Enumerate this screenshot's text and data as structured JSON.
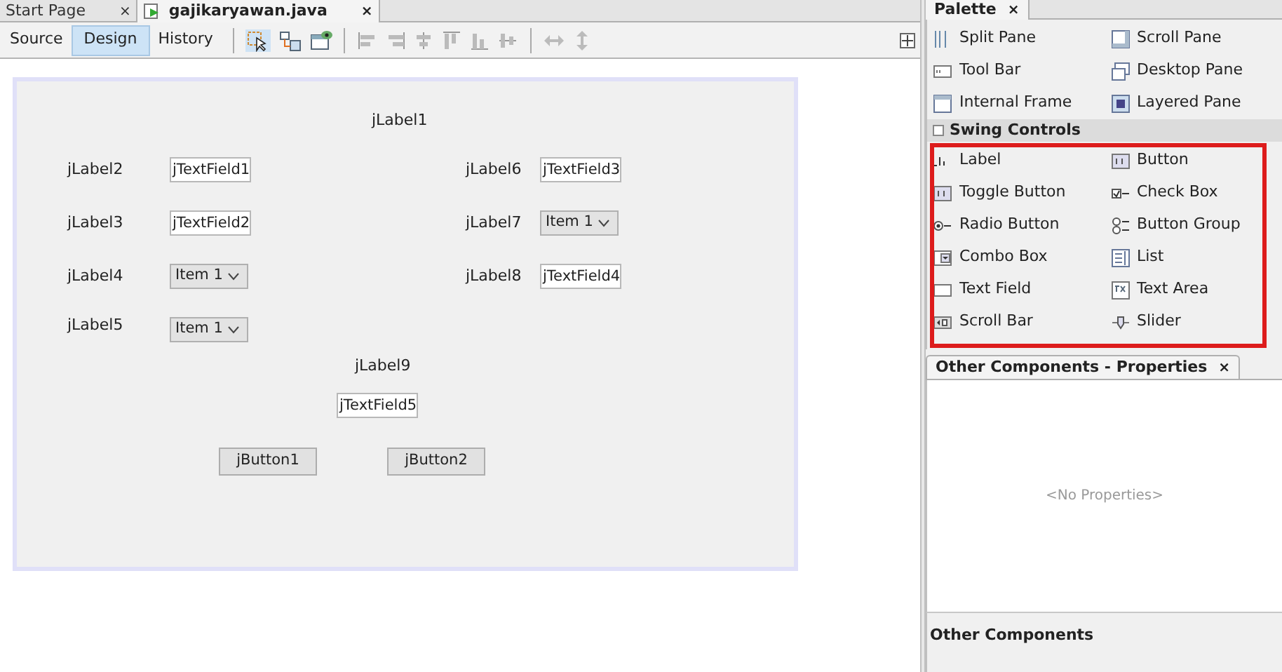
{
  "editor_tabs": [
    {
      "label": "Start Page",
      "close": "×",
      "selected": false
    },
    {
      "label": "gajikaryawan.java",
      "close": "×",
      "selected": true
    }
  ],
  "view_tabs": [
    {
      "label": "Source",
      "selected": false
    },
    {
      "label": "Design",
      "selected": true
    },
    {
      "label": "History",
      "selected": false
    }
  ],
  "form": {
    "components": [
      {
        "kind": "label",
        "text": "jLabel1"
      },
      {
        "kind": "label",
        "text": "jLabel2"
      },
      {
        "kind": "textfield",
        "text": "jTextField1"
      },
      {
        "kind": "label",
        "text": "jLabel3"
      },
      {
        "kind": "textfield",
        "text": "jTextField2"
      },
      {
        "kind": "label",
        "text": "jLabel4"
      },
      {
        "kind": "combo",
        "text": "Item 1"
      },
      {
        "kind": "label",
        "text": "jLabel5"
      },
      {
        "kind": "combo",
        "text": "Item 1"
      },
      {
        "kind": "label",
        "text": "jLabel6"
      },
      {
        "kind": "textfield",
        "text": "jTextField3"
      },
      {
        "kind": "label",
        "text": "jLabel7"
      },
      {
        "kind": "combo",
        "text": "Item 1"
      },
      {
        "kind": "label",
        "text": "jLabel8"
      },
      {
        "kind": "textfield",
        "text": "jTextField4"
      },
      {
        "kind": "label",
        "text": "jLabel9"
      },
      {
        "kind": "textfield",
        "text": "jTextField5"
      },
      {
        "kind": "button",
        "text": "jButton1"
      },
      {
        "kind": "button",
        "text": "jButton2"
      }
    ]
  },
  "palette": {
    "title": "Palette",
    "close": "×",
    "containers": [
      "Split Pane",
      "Scroll Pane",
      "Tool Bar",
      "Desktop Pane",
      "Internal Frame",
      "Layered Pane"
    ],
    "section": "Swing Controls",
    "controls": [
      "Label",
      "Button",
      "Toggle Button",
      "Check Box",
      "Radio Button",
      "Button Group",
      "Combo Box",
      "List",
      "Text Field",
      "Text Area",
      "Scroll Bar",
      "Slider"
    ]
  },
  "properties": {
    "title": "Other Components - Properties",
    "close": "×",
    "empty_text": "<No Properties>",
    "footer": "Other Components"
  }
}
